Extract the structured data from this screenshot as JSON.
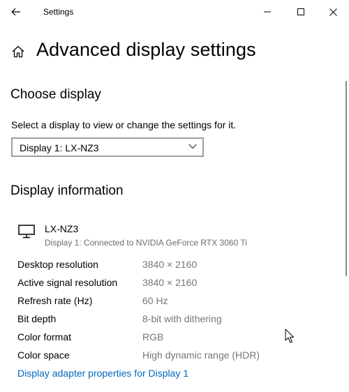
{
  "window": {
    "title": "Settings",
    "back_icon": "back-arrow-icon",
    "controls": [
      "minimize-icon",
      "maximize-icon",
      "close-icon"
    ]
  },
  "page": {
    "title": "Advanced display settings",
    "home_icon": "home-icon"
  },
  "choose_display": {
    "heading": "Choose display",
    "description": "Select a display to view or change the settings for it.",
    "selected": "Display 1: LX-NZ3"
  },
  "display_info": {
    "heading": "Display information",
    "monitor_icon": "monitor-icon",
    "monitor_name": "LX-NZ3",
    "monitor_desc": "Display 1: Connected to NVIDIA GeForce RTX 3060 Ti",
    "rows": [
      {
        "label": "Desktop resolution",
        "value": "3840 × 2160"
      },
      {
        "label": "Active signal resolution",
        "value": "3840 × 2160"
      },
      {
        "label": "Refresh rate (Hz)",
        "value": "60 Hz"
      },
      {
        "label": "Bit depth",
        "value": "8-bit with dithering"
      },
      {
        "label": "Color format",
        "value": "RGB"
      },
      {
        "label": "Color space",
        "value": "High dynamic range (HDR)"
      }
    ],
    "adapter_link": "Display adapter properties for Display 1"
  },
  "colors": {
    "link": "#0067c0",
    "secondary_text": "#767676"
  }
}
